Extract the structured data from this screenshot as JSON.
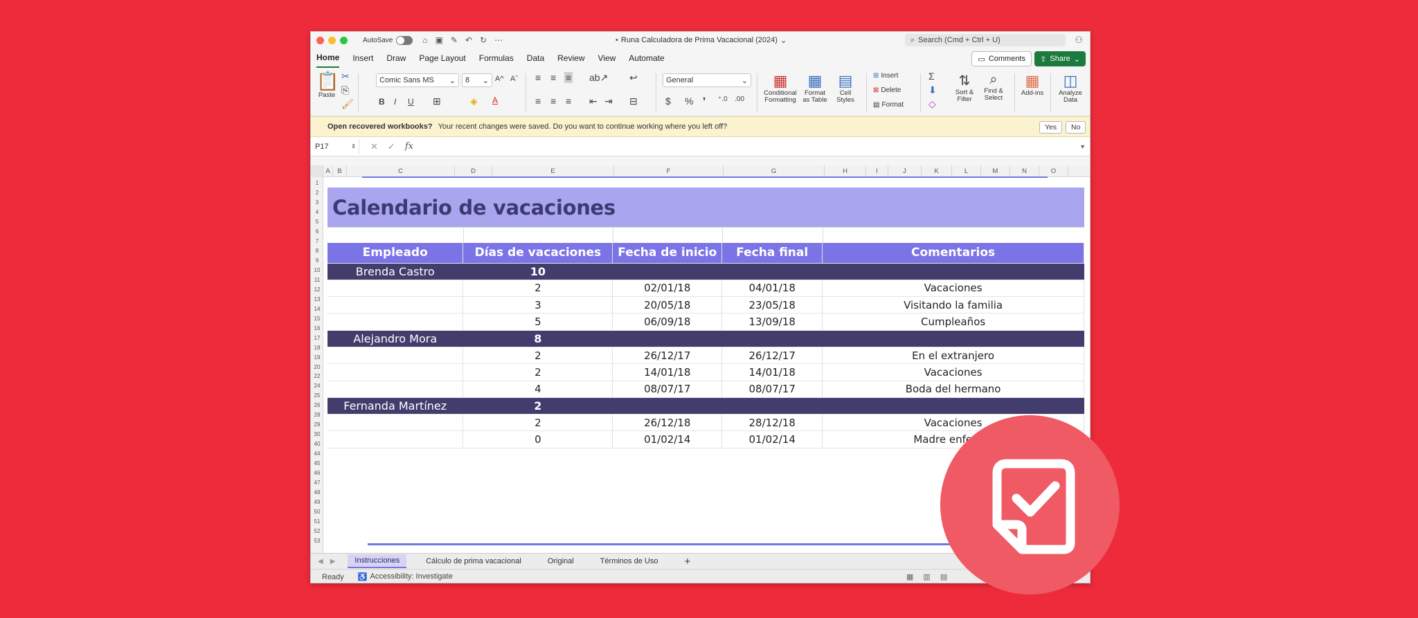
{
  "titlebar": {
    "autosave_label": "AutoSave",
    "doc_title": "Runa Calculadora de Prima Vacacional (2024)",
    "search_placeholder": "Search (Cmd + Ctrl + U)",
    "light_colors": [
      "#fe5f57",
      "#febc2e",
      "#28c840"
    ]
  },
  "menu": {
    "tabs": [
      "Home",
      "Insert",
      "Draw",
      "Page Layout",
      "Formulas",
      "Data",
      "Review",
      "View",
      "Automate"
    ],
    "comments": "Comments",
    "share": "Share"
  },
  "ribbon": {
    "paste": "Paste",
    "font_name": "Comic Sans MS",
    "font_size": "8",
    "number_format": "General",
    "conditional": "Conditional",
    "formatting": "Formatting",
    "format_as": "Format",
    "as_table": "as Table",
    "cell": "Cell",
    "styles": "Styles",
    "insert": "Insert",
    "delete": "Delete",
    "format": "Format",
    "sort": "Sort &",
    "filter": "Filter",
    "find": "Find &",
    "select": "Select",
    "addins": "Add-ins",
    "analyze": "Analyze",
    "data": "Data"
  },
  "infobar": {
    "title": "Open recovered workbooks?",
    "message": "Your recent changes were saved. Do you want to continue working where you left off?",
    "yes": "Yes",
    "no": "No"
  },
  "formula": {
    "cell_ref": "P17",
    "fx": "fx"
  },
  "columns": [
    "A",
    "B",
    "C",
    "D",
    "E",
    "F",
    "G",
    "H",
    "I",
    "J",
    "K",
    "L",
    "M",
    "N",
    "O"
  ],
  "rows": [
    "1",
    "2",
    "3",
    "4",
    "5",
    "6",
    "7",
    "8",
    "9",
    "10",
    "11",
    "12",
    "13",
    "14",
    "15",
    "16",
    "17",
    "18",
    "19",
    "20",
    "22",
    "24",
    "25",
    "26",
    "28",
    "29",
    "30",
    "40",
    "44",
    "45",
    "46",
    "47",
    "48",
    "49",
    "50",
    "51",
    "52",
    "53"
  ],
  "sheet": {
    "title": "Calendario de vacaciones",
    "headers": [
      "Empleado",
      "Días de vacaciones",
      "Fecha de inicio",
      "Fecha final",
      "Comentarios"
    ],
    "employees": [
      {
        "name": "Brenda Castro",
        "total": "10",
        "entries": [
          {
            "days": "2",
            "start": "02/01/18",
            "end": "04/01/18",
            "comment": "Vacaciones"
          },
          {
            "days": "3",
            "start": "20/05/18",
            "end": "23/05/18",
            "comment": "Visitando la familia"
          },
          {
            "days": "5",
            "start": "06/09/18",
            "end": "13/09/18",
            "comment": "Cumpleaños"
          }
        ]
      },
      {
        "name": "Alejandro Mora",
        "total": "8",
        "entries": [
          {
            "days": "2",
            "start": "26/12/17",
            "end": "26/12/17",
            "comment": "En el extranjero"
          },
          {
            "days": "2",
            "start": "14/01/18",
            "end": "14/01/18",
            "comment": "Vacaciones"
          },
          {
            "days": "4",
            "start": "08/07/17",
            "end": "08/07/17",
            "comment": "Boda del hermano"
          }
        ]
      },
      {
        "name": "Fernanda Martínez",
        "total": "2",
        "entries": [
          {
            "days": "2",
            "start": "26/12/18",
            "end": "28/12/18",
            "comment": "Vacaciones"
          },
          {
            "days": "0",
            "start": "01/02/14",
            "end": "01/02/14",
            "comment": "Madre enferma"
          }
        ]
      }
    ]
  },
  "sheet_tabs": [
    "Instrucciones",
    "Cálculo de prima vacacional",
    "Original",
    "Términos de Uso"
  ],
  "status": {
    "ready": "Ready",
    "accessibility": "Accessibility: Investigate"
  },
  "colors": {
    "background": "#ee2b3b",
    "banner": "#a9a6ef",
    "header": "#7b74e6",
    "employee_row": "#433d6e",
    "badge": "#ef5a64",
    "share": "#1d7a3e"
  }
}
